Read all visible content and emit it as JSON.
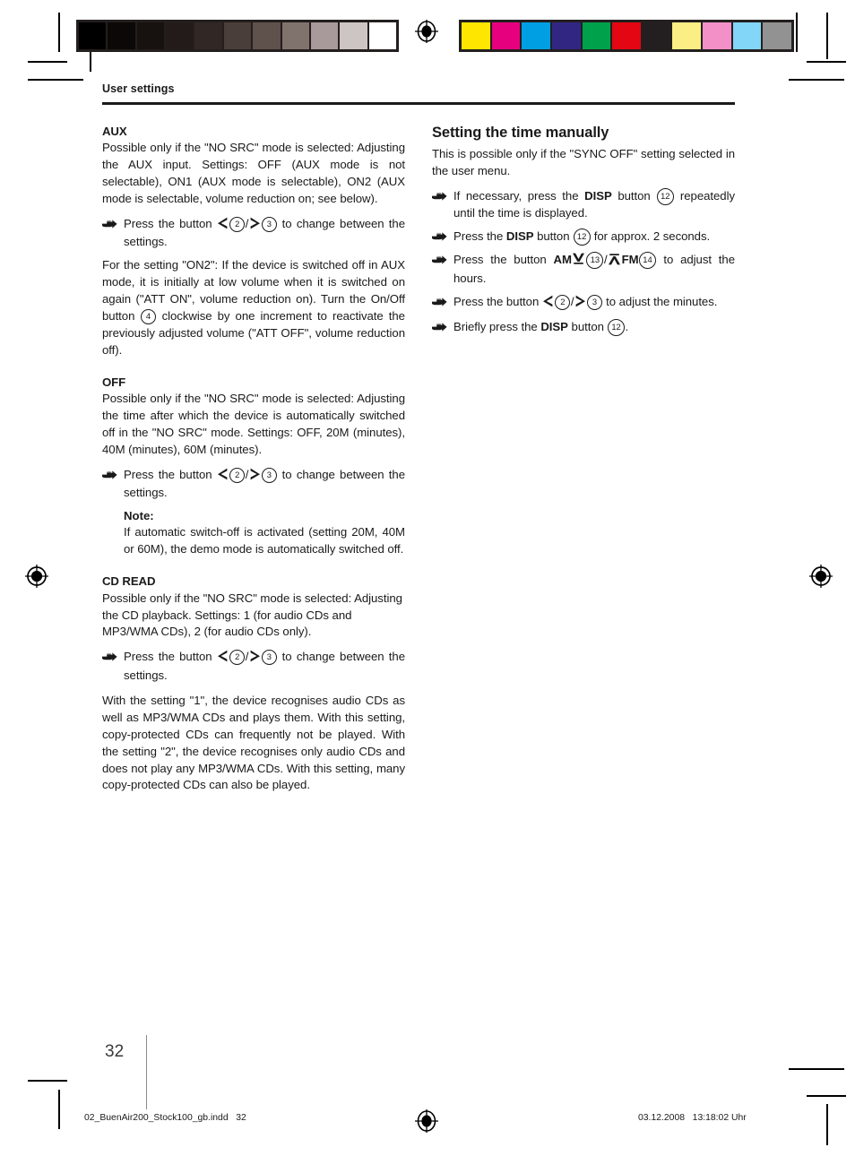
{
  "page": {
    "running_head": "User settings",
    "page_number": "32",
    "imprint_file": "02_BuenAir200_Stock100_gb.indd   32",
    "imprint_date": "03.12.2008   13:18:02 Uhr"
  },
  "print_marks": {
    "gray_strip_name": "grayscale-control-strip",
    "color_strip_name": "color-control-strip",
    "gray_swatches": [
      "#000000",
      "#0b0807",
      "#171110",
      "#231b19",
      "#312724",
      "#4a3e3a",
      "#5f514c",
      "#80736e",
      "#a8999a",
      "#cdc4c4",
      "#ffffff"
    ],
    "color_swatches": [
      "#ffe600",
      "#e6007e",
      "#009fe3",
      "#312783",
      "#00a14b",
      "#e30613",
      "#231f20",
      "#fbee84",
      "#f490c8",
      "#82d6f7",
      "#929292"
    ]
  },
  "left_column": {
    "sections": [
      {
        "title": "AUX",
        "intro": "Possible only if the \"NO SRC\" mode is selected: Adjusting the AUX input. Settings: OFF (AUX mode is not selectable), ON1 (AUX mode is selectable), ON2 (AUX mode is selectable, volume reduction on; see below).",
        "step_prefix": "Press the button",
        "step_suffix": "to change between the settings.",
        "button_left": "2",
        "button_right": "3",
        "after": "For the setting \"ON2\": If the device is switched off in AUX mode, it is initially at low volume when it is switched on again (\"ATT ON\", volume reduction on). Turn the On/Off button",
        "after_button": "4",
        "after_tail": "clockwise by one increment to reactivate the previously adjusted volume (\"ATT OFF\", volume reduction off)."
      },
      {
        "title": "OFF",
        "intro": "Possible only if the \"NO SRC\" mode is selected: Adjusting the time after which the device is automatically switched off in the \"NO SRC\" mode. Settings: OFF, 20M (minutes), 40M (minutes), 60M (minutes).",
        "step_prefix": "Press the button",
        "step_suffix": "to change between the settings.",
        "button_left": "2",
        "button_right": "3",
        "note_title": "Note:",
        "note_text": "If automatic switch-off is activated (setting 20M, 40M or 60M), the demo mode is automatically switched off."
      },
      {
        "title": "CD READ",
        "intro": "Possible only if the \"NO SRC\" mode is selected: Adjusting the CD playback. Settings: 1 (for audio CDs and MP3/WMA CDs), 2 (for audio CDs only).",
        "step_prefix": "Press the button",
        "step_suffix": "to change between the settings.",
        "button_left": "2",
        "button_right": "3",
        "after": "With the setting \"1\", the device recognises audio CDs as well as MP3/WMA CDs and plays them. With this setting, copy-protected CDs can frequently not be played. With the setting \"2\", the device recognises only audio CDs and does not play any MP3/WMA CDs. With this setting, many copy-protected CDs can also be played."
      }
    ]
  },
  "right_column": {
    "title": "Setting the time manually",
    "intro": "This is possible only if the \"SYNC OFF\" setting selected in the user menu.",
    "steps": [
      {
        "prefix": "If necessary, press the",
        "bold": "DISP",
        "mid": "button",
        "button": "12",
        "suffix": "repeatedly until the time is displayed."
      },
      {
        "prefix": "Press the",
        "bold": "DISP",
        "mid": "button",
        "button": "12",
        "suffix": "for approx. 2 seconds."
      },
      {
        "prefix": "Press the button",
        "am_label": "AM",
        "am_button": "13",
        "fm_label": "FM",
        "fm_button": "14",
        "suffix": "to adjust the hours."
      },
      {
        "prefix": "Press the button",
        "button_left": "2",
        "button_right": "3",
        "suffix": "to adjust the minutes."
      },
      {
        "prefix": "Briefly press the",
        "bold": "DISP",
        "mid": "button",
        "button": "12",
        "suffix": "."
      }
    ]
  }
}
